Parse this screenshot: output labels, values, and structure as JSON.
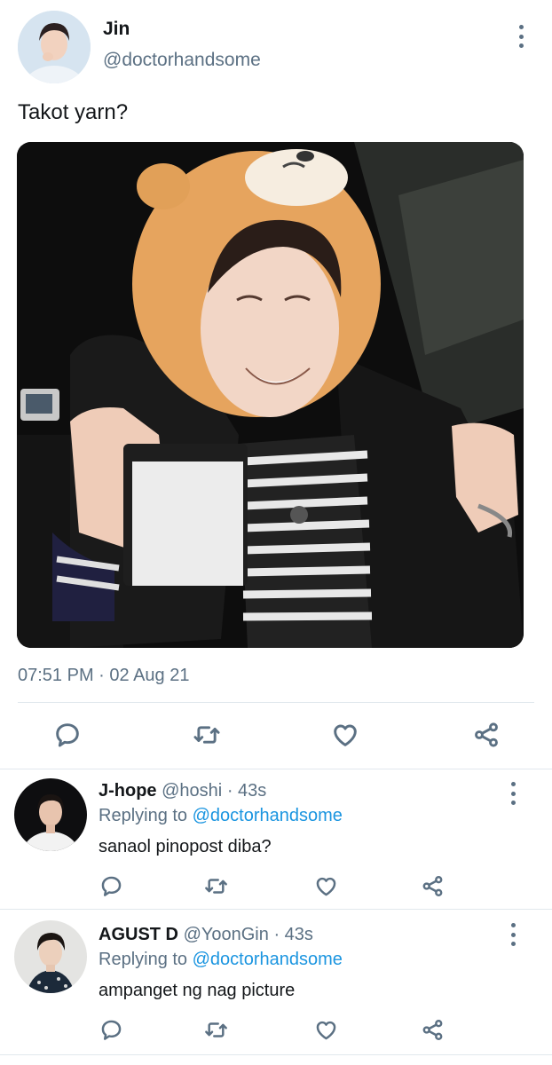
{
  "tweet": {
    "author_name": "Jin",
    "author_handle": "@doctorhandsome",
    "text": "Takot yarn?",
    "timestamp": "07:51 PM · 02 Aug 21",
    "media_description": "person in bear hat grimacing",
    "actions": [
      "reply-icon",
      "retweet-icon",
      "like-icon",
      "share-icon"
    ]
  },
  "replies": [
    {
      "name": "J-hope",
      "handle": "@hoshi",
      "time": "· 43s",
      "replying_prefix": "Replying to ",
      "replying_to": "@doctorhandsome",
      "text": "sanaol pinopost diba?"
    },
    {
      "name": "AGUST D",
      "handle": "@YoonGin",
      "time": "· 43s",
      "replying_prefix": "Replying to ",
      "replying_to": "@doctorhandsome",
      "text": "ampanget ng nag picture"
    }
  ],
  "colors": {
    "text": "#14171a",
    "secondary": "#5b7083",
    "link": "#1b95e0",
    "divider": "#e1e8ed"
  }
}
